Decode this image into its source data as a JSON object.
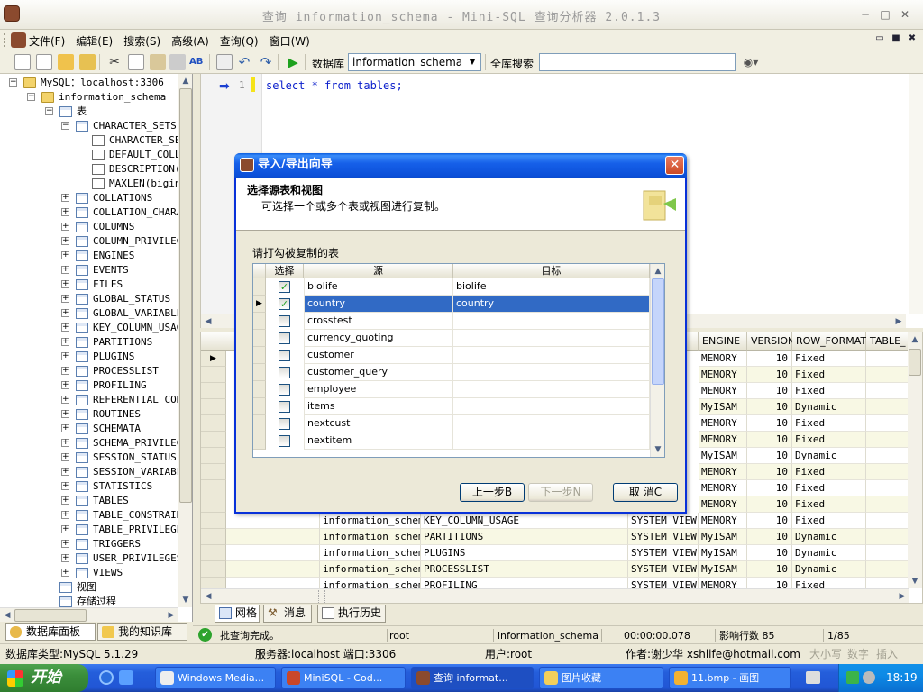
{
  "window": {
    "title": "查询 information_schema - Mini-SQL 查询分析器 2.0.1.3"
  },
  "menu": [
    "文件(F)",
    "编辑(E)",
    "搜索(S)",
    "高级(A)",
    "查询(Q)",
    "窗口(W)"
  ],
  "toolbar": {
    "db_label": "数据库",
    "db_value": "information_schema",
    "search_label": "全库搜索",
    "search_value": ""
  },
  "tree": {
    "root": "MySQL：localhost:3306",
    "schema": "information_schema",
    "tables_node": "表",
    "char_sets": "CHARACTER_SETS",
    "columns": [
      "CHARACTER_SET",
      "DEFAULT_COLLA",
      "DESCRIPTION(",
      "MAXLEN(bigin"
    ],
    "tables": [
      "COLLATIONS",
      "COLLATION_CHARAC",
      "COLUMNS",
      "COLUMN_PRIVILEGE",
      "ENGINES",
      "EVENTS",
      "FILES",
      "GLOBAL_STATUS",
      "GLOBAL_VARIABLES",
      "KEY_COLUMN_USAGE",
      "PARTITIONS",
      "PLUGINS",
      "PROCESSLIST",
      "PROFILING",
      "REFERENTIAL_CONS",
      "ROUTINES",
      "SCHEMATA",
      "SCHEMA_PRIVILEGE",
      "SESSION_STATUS",
      "SESSION_VARIABLE",
      "STATISTICS",
      "TABLES",
      "TABLE_CONSTRAINT",
      "TABLE_PRIVILEGES",
      "TRIGGERS",
      "USER_PRIVILEGES",
      "VIEWS"
    ],
    "views": "视图",
    "procs": "存储过程"
  },
  "left_tabs": [
    "数据库面板",
    "我的知识库"
  ],
  "editor": {
    "line": "1",
    "code": "select * from tables;"
  },
  "grid": {
    "headers": [
      "ENGINE",
      "VERSION",
      "ROW_FORMAT",
      "TABLE_"
    ],
    "top_rows": [
      [
        "MEMORY",
        "10",
        "Fixed"
      ],
      [
        "MEMORY",
        "10",
        "Fixed"
      ],
      [
        "MEMORY",
        "10",
        "Fixed"
      ],
      [
        "MyISAM",
        "10",
        "Dynamic"
      ],
      [
        "MEMORY",
        "10",
        "Fixed"
      ],
      [
        "MEMORY",
        "10",
        "Fixed"
      ],
      [
        "MyISAM",
        "10",
        "Dynamic"
      ],
      [
        "MEMORY",
        "10",
        "Fixed"
      ],
      [
        "MEMORY",
        "10",
        "Fixed"
      ],
      [
        "MEMORY",
        "10",
        "Fixed"
      ]
    ],
    "full_rows": [
      [
        "information_schema",
        "KEY_COLUMN_USAGE",
        "SYSTEM VIEW",
        "MEMORY",
        "10",
        "Fixed"
      ],
      [
        "information_schema",
        "PARTITIONS",
        "SYSTEM VIEW",
        "MyISAM",
        "10",
        "Dynamic"
      ],
      [
        "information_schema",
        "PLUGINS",
        "SYSTEM VIEW",
        "MyISAM",
        "10",
        "Dynamic"
      ],
      [
        "information_schema",
        "PROCESSLIST",
        "SYSTEM VIEW",
        "MyISAM",
        "10",
        "Dynamic"
      ],
      [
        "information_schema",
        "PROFILING",
        "SYSTEM VIEW",
        "MEMORY",
        "10",
        "Fixed"
      ]
    ]
  },
  "bottom_tabs": [
    "网格",
    "消息",
    "执行历史"
  ],
  "status1": {
    "msg": "批查询完成。",
    "user": "root",
    "db": "information_schema",
    "time": "00:00:00.078",
    "rows": "影响行数 85",
    "pos": "1/85"
  },
  "status2": {
    "dbtype": "数据库类型:MySQL 5.1.29",
    "server": "服务器:localhost  端口:3306",
    "user": "用户:root",
    "author": "作者:谢少华  xshlife@hotmail.com",
    "caps": "大小写",
    "num": "数字",
    "ins": "插入"
  },
  "dialog": {
    "title": "导入/导出向导",
    "heading": "选择源表和视图",
    "sub": "可选择一个或多个表或视图进行复制。",
    "list_label": "请打勾被复制的表",
    "col_select": "选择",
    "col_source": "源",
    "col_target": "目标",
    "rows": [
      {
        "src": "biolife",
        "dst": "biolife",
        "checked": true
      },
      {
        "src": "country",
        "dst": "country",
        "checked": true
      },
      {
        "src": "crosstest",
        "dst": "",
        "checked": false
      },
      {
        "src": "currency_quoting",
        "dst": "",
        "checked": false
      },
      {
        "src": "customer",
        "dst": "",
        "checked": false
      },
      {
        "src": "customer_query",
        "dst": "",
        "checked": false
      },
      {
        "src": "employee",
        "dst": "",
        "checked": false
      },
      {
        "src": "items",
        "dst": "",
        "checked": false
      },
      {
        "src": "nextcust",
        "dst": "",
        "checked": false
      },
      {
        "src": "nextitem",
        "dst": "",
        "checked": false
      }
    ],
    "btn_prev": "上一步B",
    "btn_next": "下一步N",
    "btn_cancel": "取 消C"
  },
  "taskbar": {
    "start": "开始",
    "buttons": [
      "Windows Media...",
      "MiniSQL - Cod...",
      "查询 informat...",
      "图片收藏",
      "11.bmp - 画图"
    ],
    "clock": "18:19"
  }
}
